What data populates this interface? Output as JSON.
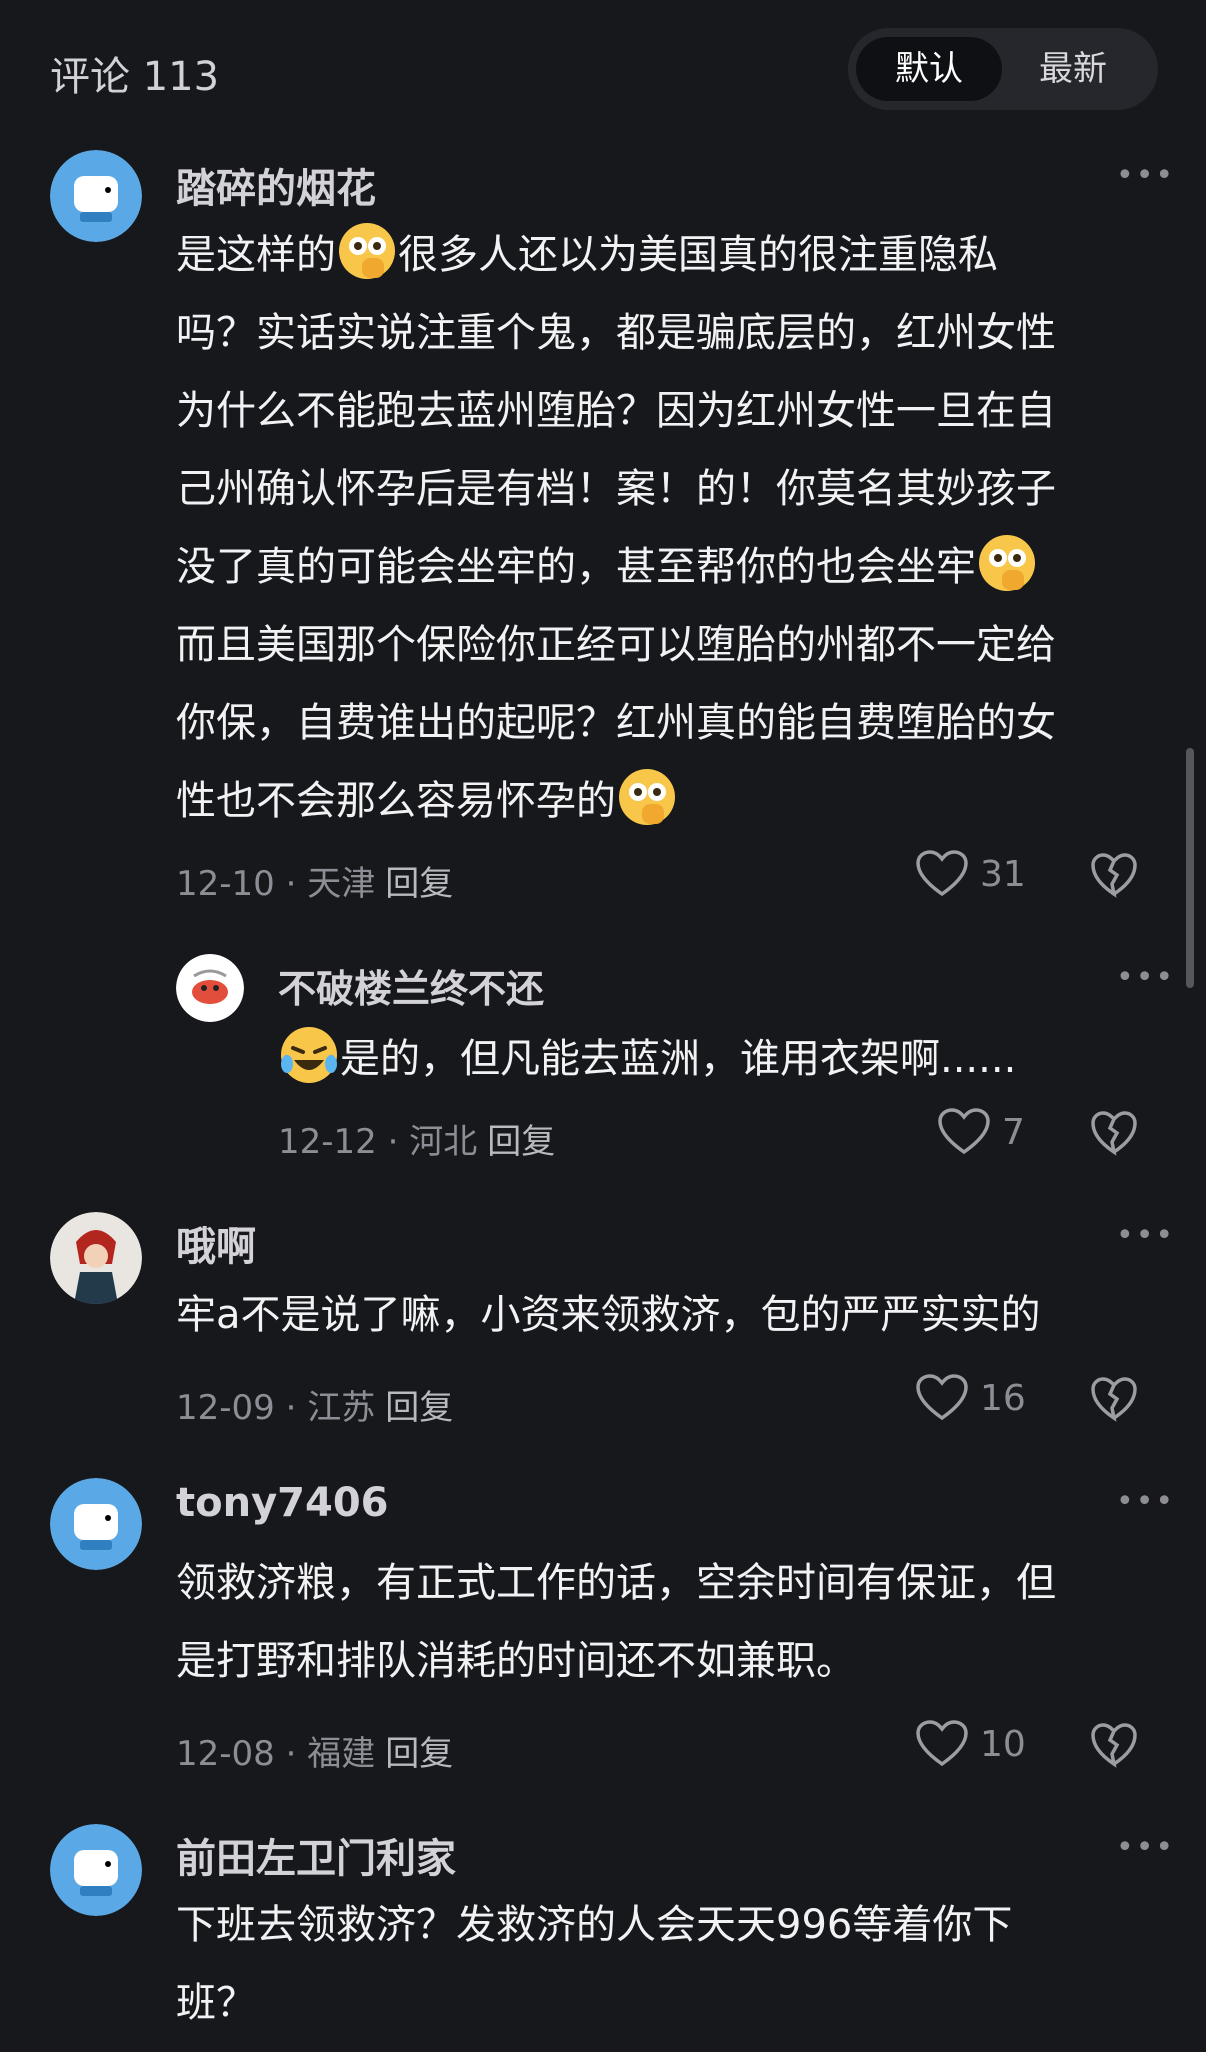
{
  "header": {
    "title": "评论 113",
    "sort": [
      "默认",
      "最新"
    ],
    "active_sort": "默认"
  },
  "comments": [
    {
      "name": "踏碎的烟花",
      "lines": [
        [
          "是这样的",
          "[emoji-peek]",
          "很多人还以为美国真的很注重隐私"
        ],
        [
          "吗？实话实说注重个鬼，都是骗底层的，红州女性"
        ],
        [
          "为什么不能跑去蓝州堕胎？因为红州女性一旦在自"
        ],
        [
          "己州确认怀孕后是有档！案！的！你莫名其妙孩子"
        ],
        [
          "没了真的可能会坐牢的，甚至帮你的也会坐牢",
          "[emoji-peek]"
        ],
        [
          "而且美国那个保险你正经可以堕胎的州都不一定给"
        ],
        [
          "你保，自费谁出的起呢？红州真的能自费堕胎的女"
        ],
        [
          "性也不会那么容易怀孕的",
          "[emoji-peek]"
        ]
      ],
      "date": "12-10",
      "location": "天津",
      "reply_label": "回复",
      "likes": "31"
    },
    {
      "name": "不破楼兰终不还",
      "lines": [
        [
          "[emoji-laugh-cry]",
          "是的，但凡能去蓝洲，谁用衣架啊......"
        ]
      ],
      "date": "12-12",
      "location": "河北",
      "reply_label": "回复",
      "likes": "7"
    },
    {
      "name": "哦啊",
      "lines": [
        [
          "牢a不是说了嘛，小资来领救济，包的严严实实的"
        ]
      ],
      "date": "12-09",
      "location": "江苏",
      "reply_label": "回复",
      "likes": "16"
    },
    {
      "name": "tony7406",
      "lines": [
        [
          "领救济粮，有正式工作的话，空余时间有保证，但"
        ],
        [
          "是打野和排队消耗的时间还不如兼职。"
        ]
      ],
      "date": "12-08",
      "location": "福建",
      "reply_label": "回复",
      "likes": "10"
    },
    {
      "name": "前田左卫门利家",
      "lines": [
        [
          "下班去领救济？发救济的人会天天996等着你下"
        ],
        [
          "班？"
        ]
      ],
      "date": "",
      "location": "",
      "reply_label": "",
      "likes": ""
    }
  ],
  "icons": {
    "more": "more-dots-icon",
    "like": "heart-icon",
    "dislike": "broken-heart-icon"
  },
  "colors": {
    "background": "#17181c",
    "text": "#f2f2f4",
    "meta": "#8d8e95",
    "avatar_bg": "#5aa9e6"
  }
}
